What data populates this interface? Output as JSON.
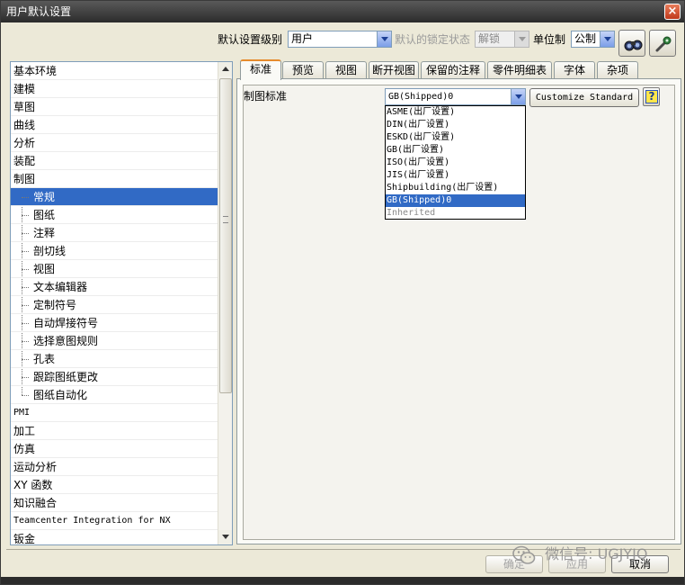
{
  "window": {
    "title": "用户默认设置",
    "close_label": "×"
  },
  "toolbar": {
    "level_label": "默认设置级别",
    "level_value": "用户",
    "lock_label": "默认的锁定状态",
    "lock_value": "解锁",
    "unit_label": "单位制",
    "unit_value": "公制"
  },
  "tree": {
    "items": [
      "基本环境",
      "建模",
      "草图",
      "曲线",
      "分析",
      "装配",
      "制图",
      "常规",
      "图纸",
      "注释",
      "剖切线",
      "视图",
      "文本编辑器",
      "定制符号",
      "自动焊接符号",
      "选择意图规则",
      "孔表",
      "跟踪图纸更改",
      "图纸自动化",
      "PMI",
      "加工",
      "仿真",
      "运动分析",
      "XY 函数",
      "知识融合",
      "Teamcenter Integration for NX",
      "钣金"
    ]
  },
  "tabs": [
    "标准",
    "预览",
    "视图",
    "断开视图",
    "保留的注释",
    "零件明细表",
    "字体",
    "杂项"
  ],
  "standard": {
    "label": "制图标准",
    "value": "GB(Shipped)0",
    "customize_label": "Customize Standard",
    "help_label": "?",
    "options": [
      "ASME(出厂设置)",
      "DIN(出厂设置)",
      "ESKD(出厂设置)",
      "GB(出厂设置)",
      "ISO(出厂设置)",
      "JIS(出厂设置)",
      "Shipbuilding(出厂设置)",
      "GB(Shipped)0",
      "Inherited"
    ],
    "selected_index": 7
  },
  "buttons": {
    "ok": "确定",
    "apply": "应用",
    "cancel": "取消"
  },
  "watermark": "微信号: UGJYJQ"
}
